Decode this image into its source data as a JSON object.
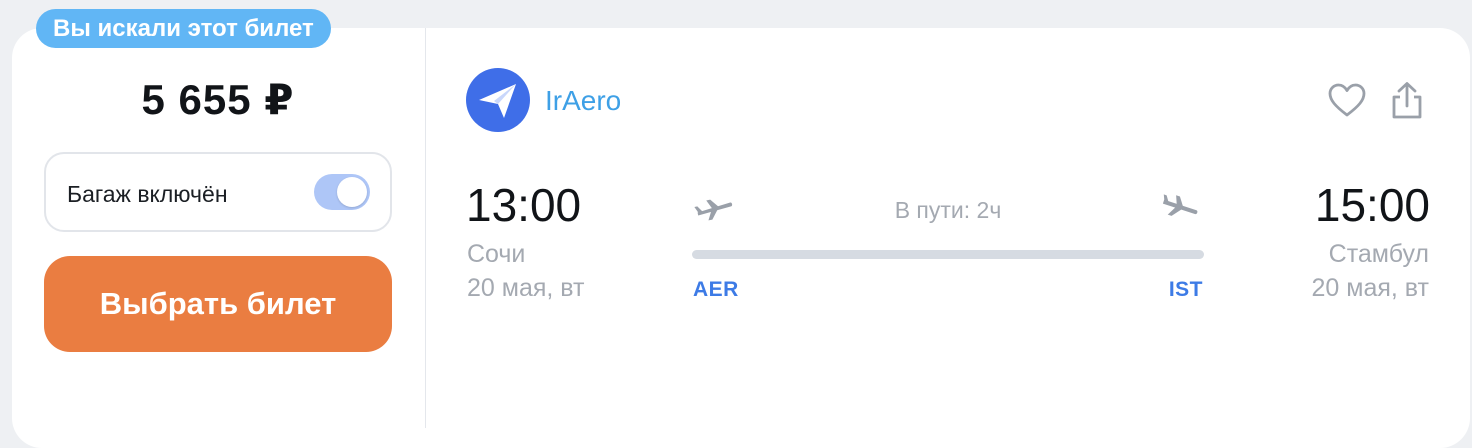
{
  "badge": {
    "text": "Вы искали этот билет"
  },
  "ticket": {
    "price": "5 655 ₽",
    "baggage_label": "Багаж включён",
    "baggage_included": true,
    "select_label": "Выбрать билет"
  },
  "airline": {
    "name": "IrAero"
  },
  "flight": {
    "departure": {
      "time": "13:00",
      "city": "Сочи",
      "date": "20 мая, вт",
      "code": "AER"
    },
    "arrival": {
      "time": "15:00",
      "city": "Стамбул",
      "date": "20 мая, вт",
      "code": "IST"
    },
    "duration": "В пути: 2ч"
  },
  "actions": {
    "favorite_icon": "heart-icon",
    "share_icon": "share-icon"
  },
  "colors": {
    "badge": "#61b6f5",
    "select_button": "#ea7d41",
    "toggle_on": "#aec6f7",
    "logo": "#3f6ee8",
    "airline_name": "#3ea0e6",
    "airport_code": "#3d7be6"
  }
}
